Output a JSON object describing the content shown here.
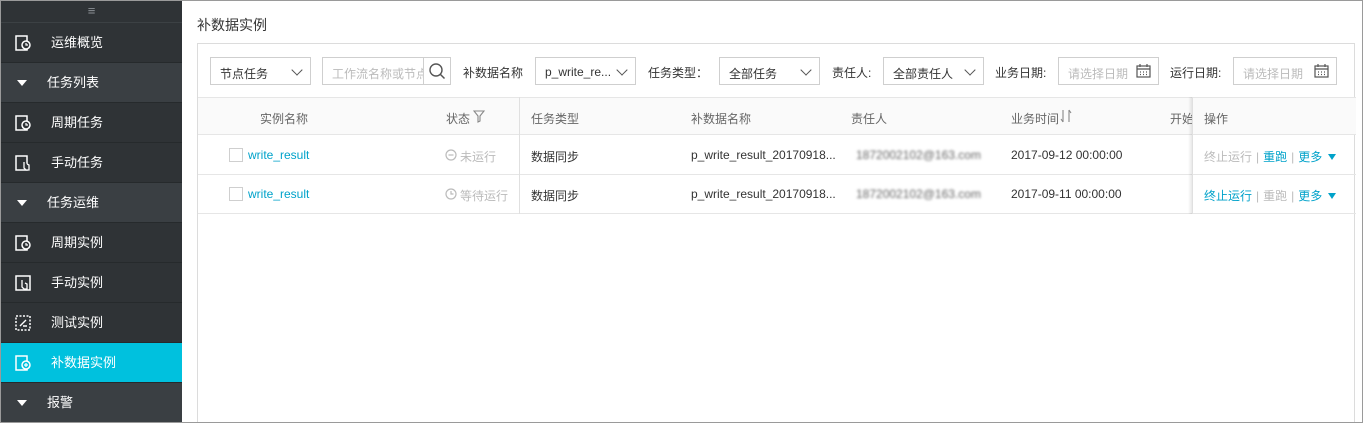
{
  "sidebar": {
    "items": [
      {
        "label": "运维概览",
        "icon": "overview-icon",
        "type": "item"
      },
      {
        "label": "任务列表",
        "type": "group"
      },
      {
        "label": "周期任务",
        "icon": "cycle-task-icon",
        "type": "item"
      },
      {
        "label": "手动任务",
        "icon": "manual-task-icon",
        "type": "item"
      },
      {
        "label": "任务运维",
        "type": "group"
      },
      {
        "label": "周期实例",
        "icon": "cycle-instance-icon",
        "type": "item"
      },
      {
        "label": "手动实例",
        "icon": "manual-instance-icon",
        "type": "item"
      },
      {
        "label": "测试实例",
        "icon": "test-instance-icon",
        "type": "item"
      },
      {
        "label": "补数据实例",
        "icon": "backfill-instance-icon",
        "type": "item",
        "active": true
      },
      {
        "label": "报警",
        "type": "group"
      }
    ]
  },
  "page": {
    "title": "补数据实例"
  },
  "filters": {
    "node_type": "节点任务",
    "search_placeholder": "工作流名称或节点",
    "backfill_label": "补数据名称",
    "backfill_value": "p_write_re...",
    "task_type_label": "任务类型：",
    "task_type_value": "全部任务",
    "owner_label": "责任人:",
    "owner_value": "全部责任人",
    "biz_date_label": "业务日期:",
    "biz_date_placeholder": "请选择日期",
    "run_date_label": "运行日期:",
    "run_date_placeholder": "请选择日期"
  },
  "table": {
    "headers": {
      "name": "实例名称",
      "status": "状态",
      "task_type": "任务类型",
      "backfill_name": "补数据名称",
      "owner": "责任人",
      "biz_time": "业务时间",
      "start": "开始",
      "ops": "操作"
    },
    "rows": [
      {
        "name": "write_result",
        "status": "未运行",
        "task_type": "数据同步",
        "backfill_name": "p_write_result_20170918...",
        "owner": "1872002102@163.com",
        "biz_time": "2017-09-12 00:00:00",
        "op_stop": "终止运行",
        "op_rerun": "重跑",
        "op_more": "更多"
      },
      {
        "name": "write_result",
        "status": "等待运行",
        "task_type": "数据同步",
        "backfill_name": "p_write_result_20170918...",
        "owner": "1872002102@163.com",
        "biz_time": "2017-09-11 00:00:00",
        "op_stop": "终止运行",
        "op_rerun": "重跑",
        "op_more": "更多"
      }
    ]
  },
  "colors": {
    "accent": "#00c1de",
    "link": "#00a2ca",
    "sidebar_bg": "#2f3336"
  }
}
